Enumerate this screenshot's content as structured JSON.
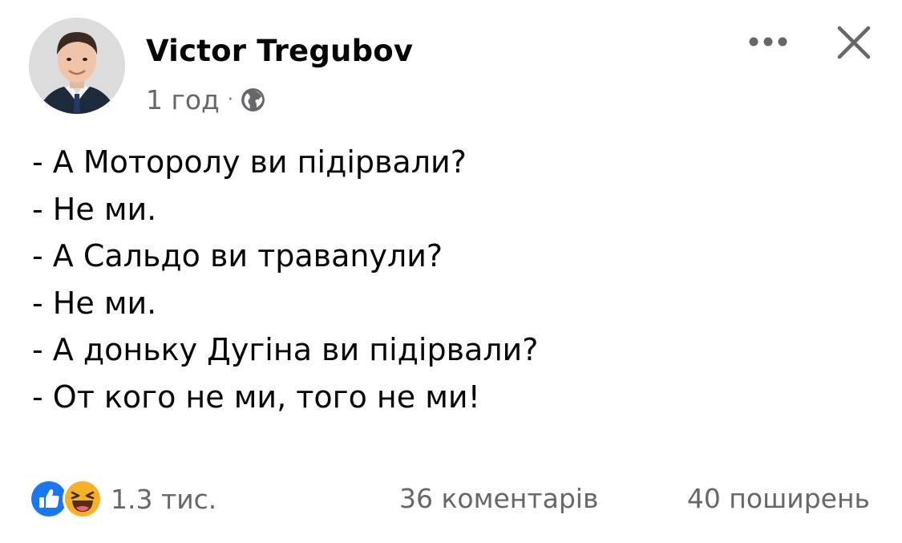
{
  "post": {
    "author": {
      "name": "Victor Tregubov",
      "avatar_icon": "profile-photo"
    },
    "meta": {
      "time": "1 год",
      "separator": "·",
      "privacy_icon": "globe-icon"
    },
    "actions": {
      "more_icon": "more-horizontal-icon",
      "close_icon": "close-icon"
    },
    "lines": [
      "- А Моторолу ви підірвали?",
      "- Не ми.",
      "- А Сальдо ви травanули?",
      "- Не ми.",
      "- А доньку Дугіна ви підірвали?",
      "- От кого не ми, того не ми!"
    ],
    "footer": {
      "reactions": [
        "like-icon",
        "haha-icon"
      ],
      "reaction_count": "1.3 тис.",
      "comments": "36 коментарів",
      "shares": "40 поширень"
    }
  },
  "colors": {
    "text_primary": "#050505",
    "text_secondary": "#65676b",
    "like_blue": "#1877f2",
    "haha_yellow": "#f7b125"
  }
}
